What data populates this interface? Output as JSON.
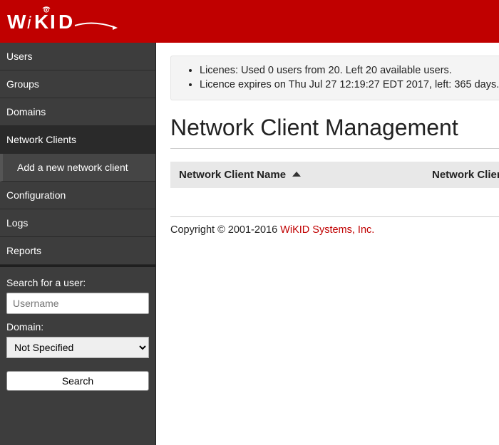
{
  "brand": "WiKID",
  "sidebar": {
    "items": [
      {
        "label": "Users"
      },
      {
        "label": "Groups"
      },
      {
        "label": "Domains"
      },
      {
        "label": "Network Clients",
        "active": true,
        "sub": [
          {
            "label": "Add a new network client"
          }
        ]
      },
      {
        "label": "Configuration"
      },
      {
        "label": "Logs"
      },
      {
        "label": "Reports"
      }
    ],
    "search": {
      "user_label": "Search for a user:",
      "user_placeholder": "Username",
      "domain_label": "Domain:",
      "domain_selected": "Not Specified",
      "button": "Search"
    }
  },
  "notice": {
    "line1": "Licenes: Used 0 users from 20. Left 20 available users.",
    "line2": "Licence expires on Thu Jul 27 12:19:27 EDT 2017, left: 365 days."
  },
  "page_title": "Network Client Management",
  "table": {
    "col1": "Network Client Name",
    "col2": "Network Client IP"
  },
  "footer": {
    "copyright": "Copyright © 2001-2016 ",
    "link_text": "WiKID Systems, Inc."
  }
}
